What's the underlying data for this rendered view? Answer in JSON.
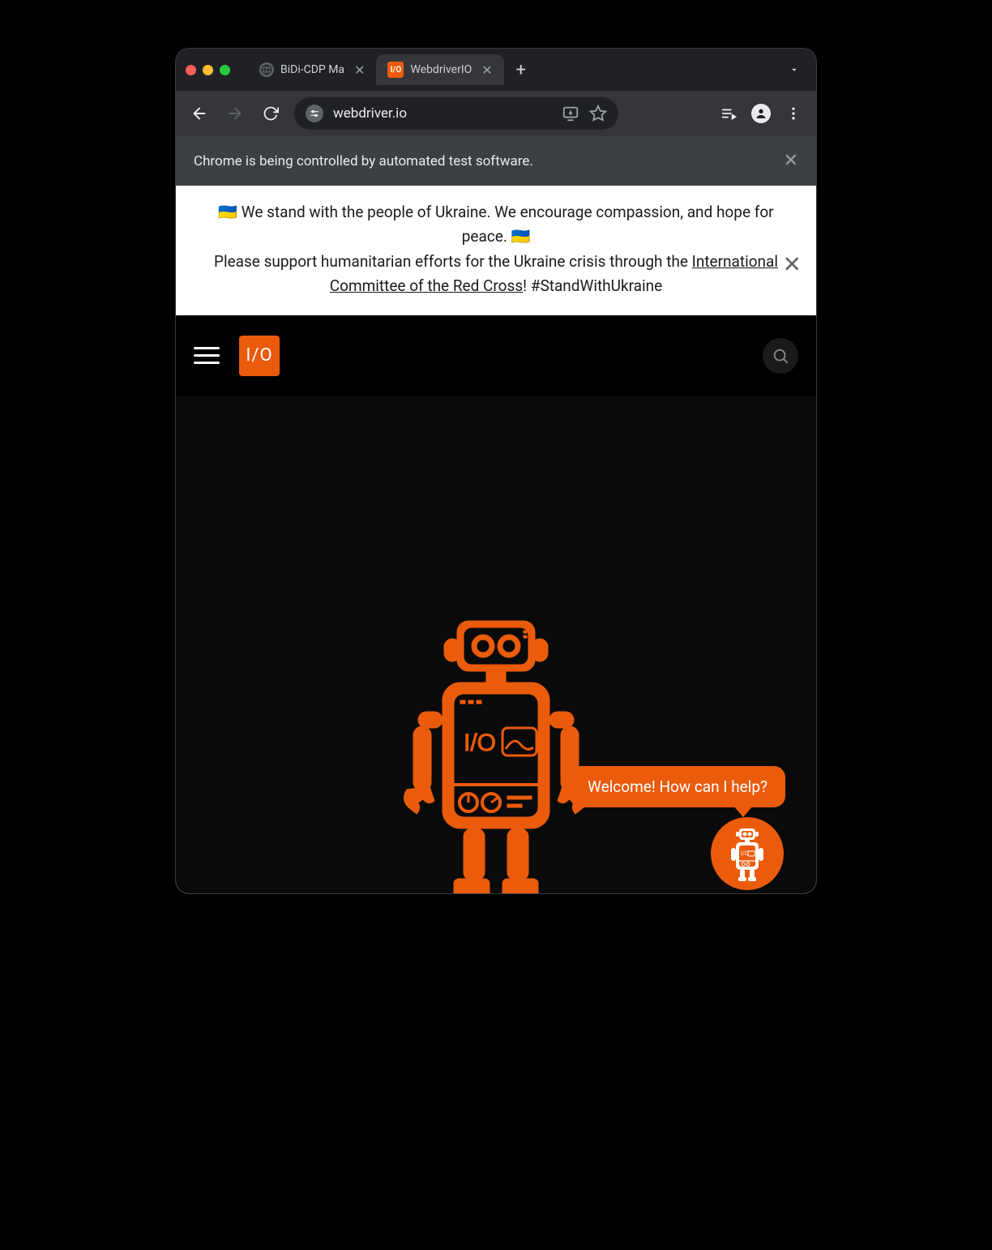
{
  "tabs": [
    {
      "title": "BiDi-CDP Ma",
      "active": false
    },
    {
      "title": "WebdriverIO",
      "active": true
    }
  ],
  "toolbar": {
    "url": "webdriver.io"
  },
  "infobar": {
    "message": "Chrome is being controlled by automated test software."
  },
  "banner": {
    "line1_pre": "🇺🇦  We stand with the people of Ukraine. We encourage compassion, and hope for peace.  🇺🇦",
    "line2_pre": "Please support humanitarian efforts for the Ukraine crisis through the ",
    "link_text": "International Committee of the Red Cross",
    "line2_post": "! #StandWithUkraine"
  },
  "header": {
    "logo_text": "I/O"
  },
  "chat": {
    "bubble": "Welcome! How can I help?"
  }
}
